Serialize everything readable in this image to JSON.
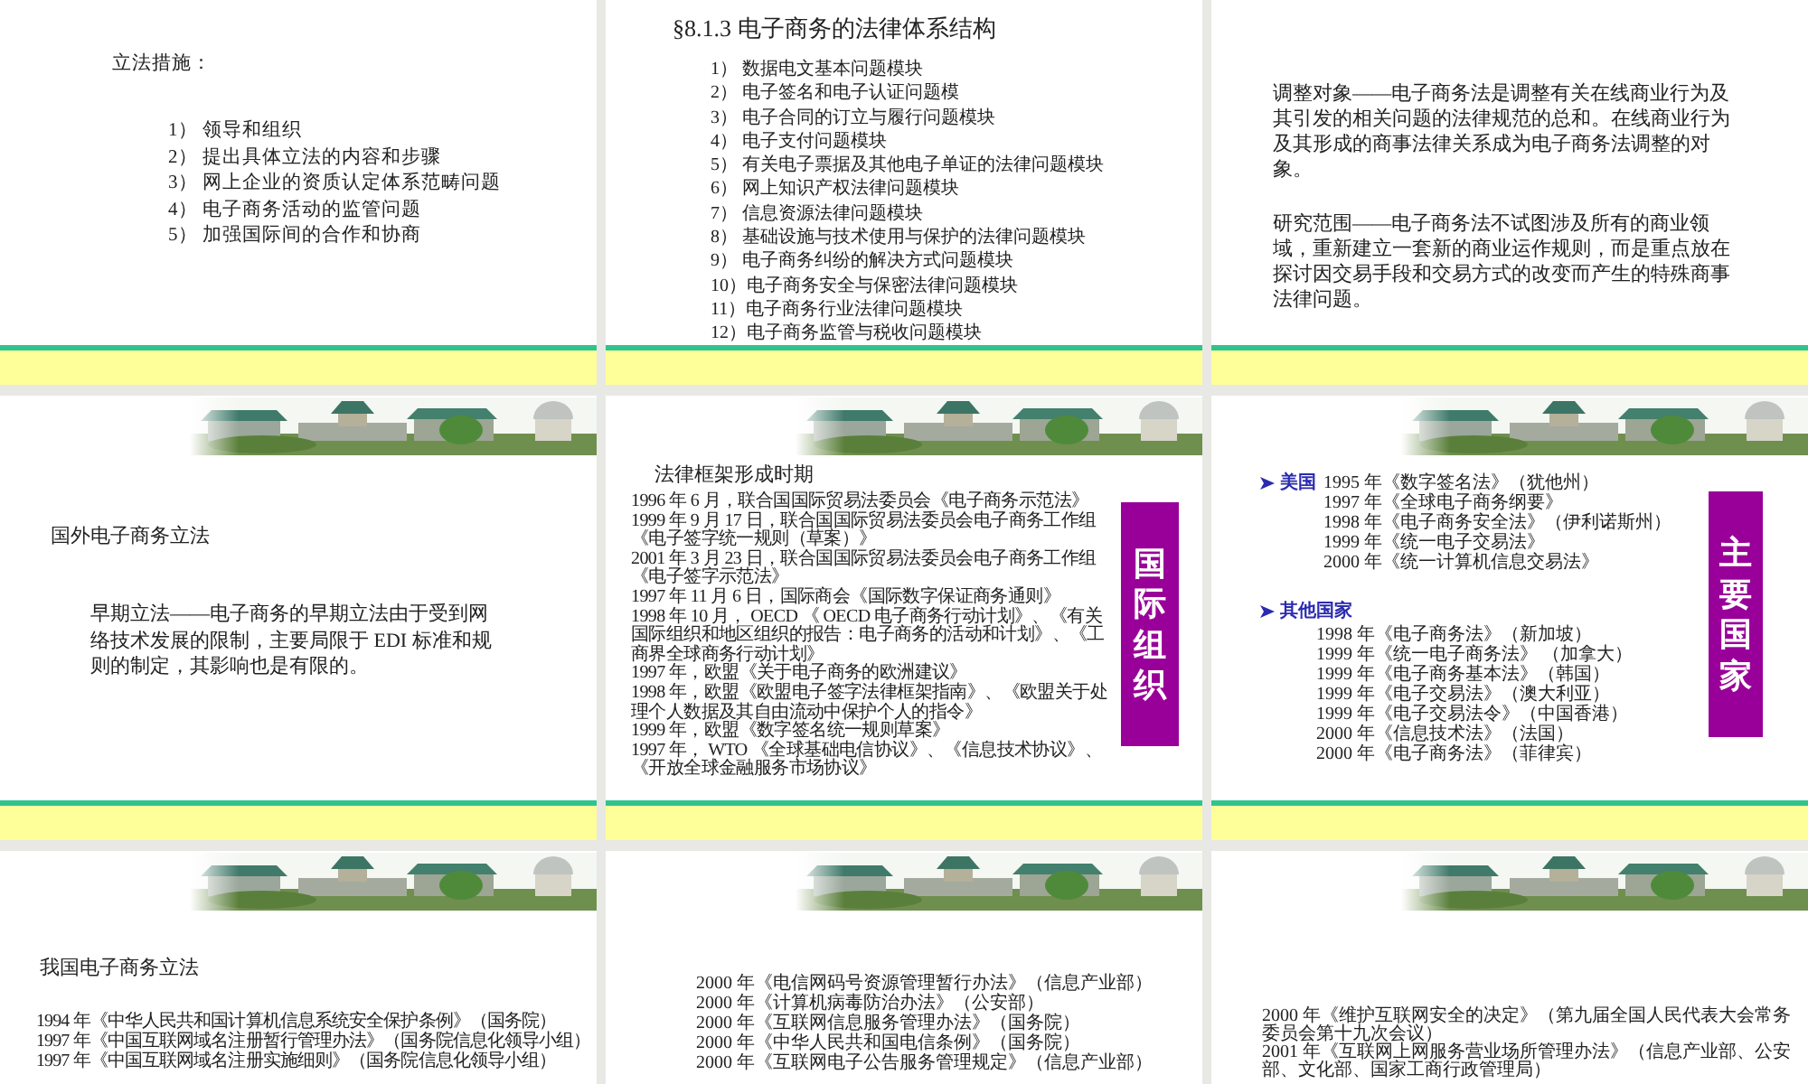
{
  "slides": [
    {
      "banner": false,
      "blocks": [
        {
          "kind": "heading",
          "text": "立法措施："
        },
        {
          "kind": "list",
          "items": [
            "1） 领导和组织",
            "2） 提出具体立法的内容和步骤",
            "3） 网上企业的资质认定体系范畴问题",
            "4） 电子商务活动的监管问题",
            "5） 加强国际间的合作和协商"
          ]
        }
      ]
    },
    {
      "banner": false,
      "blocks": [
        {
          "kind": "title",
          "text": "§8.1.3  电子商务的法律体系结构"
        },
        {
          "kind": "list",
          "items": [
            "1） 数据电文基本问题模块",
            "2） 电子签名和电子认证问题模",
            "3） 电子合同的订立与履行问题模块",
            "4） 电子支付问题模块",
            "5） 有关电子票据及其他电子单证的法律问题模块",
            "6） 网上知识产权法律问题模块",
            "7） 信息资源法律问题模块",
            "8） 基础设施与技术使用与保护的法律问题模块",
            "9） 电子商务纠纷的解决方式问题模块",
            "10）电子商务安全与保密法律问题模块",
            "11）电子商务行业法律问题模块",
            "12）电子商务监管与税收问题模块"
          ]
        }
      ]
    },
    {
      "banner": false,
      "blocks": [
        {
          "kind": "paragraph",
          "text": "调整对象——电子商务法是调整有关在线商业行为及其引发的相关问题的法律规范的总和。在线商业行为及其形成的商事法律关系成为电子商务法调整的对象。"
        },
        {
          "kind": "paragraph",
          "text": "研究范围——电子商务法不试图涉及所有的商业领域，重新建立一套新的商业运作规则，而是重点放在探讨因交易手段和交易方式的改变而产生的特殊商事法律问题。"
        }
      ]
    },
    {
      "banner": true,
      "blocks": [
        {
          "kind": "heading",
          "text": "国外电子商务立法"
        },
        {
          "kind": "paragraph",
          "text": "早期立法——电子商务的早期立法由于受到网络技术发展的限制，主要局限于  EDI 标准和规则的制定，其影响也是有限的。"
        }
      ]
    },
    {
      "banner": true,
      "side_label": "国际组织",
      "blocks": [
        {
          "kind": "heading",
          "text": "法律框架形成时期"
        },
        {
          "kind": "list",
          "items": [
            "1996 年 6 月，联合国国际贸易法委员会《电子商务示范法》",
            "1999 年 9 月 17 日，联合国国际贸易法委员会电子商务工作组《电子签字统一规则（草案）》",
            "2001 年 3 月 23 日，联合国国际贸易法委员会电子商务工作组《电子签字示范法》",
            "1997 年 11 月 6 日，国际商会《国际数字保证商务通则》",
            "1998 年 10 月， OECD 《 OECD 电子商务行动计划》、《有关国际组织和地区组织的报告：电子商务的活动和计划》、《工商界全球商务行动计划》",
            "1997 年，欧盟《关于电子商务的欧洲建议》",
            "1998 年，欧盟《欧盟电子签字法律框架指南》、《欧盟关于处理个人数据及其自由流动中保护个人的指令》",
            "1999 年，欧盟《数字签名统一规则草案》",
            "1997 年， WTO 《全球基础电信协议》、《信息技术协议》、《开放全球金融服务市场协议》"
          ]
        }
      ]
    },
    {
      "banner": true,
      "side_label": "主要国家",
      "blocks": [
        {
          "kind": "group",
          "label": "美国",
          "items": [
            "1995 年《数字签名法》（犹他州）",
            "1997 年《全球电子商务纲要》",
            "1998 年《电子商务安全法》（伊利诺斯州）",
            "1999 年《统一电子交易法》",
            "2000 年《统一计算机信息交易法》"
          ]
        },
        {
          "kind": "group",
          "label": "其他国家",
          "items": [
            "1998 年《电子商务法》（新加坡）",
            "1999 年《统一电子商务法》 （加拿大）",
            "1999 年《电子商务基本法》（韩国）",
            "1999 年《电子交易法》（澳大利亚）",
            "1999 年《电子交易法令》（中国香港）",
            "2000 年《信息技术法》（法国）",
            "2000 年《电子商务法》（菲律宾）"
          ]
        }
      ]
    },
    {
      "banner": true,
      "blocks": [
        {
          "kind": "heading",
          "text": "我国电子商务立法"
        },
        {
          "kind": "list",
          "items": [
            "1994 年《中华人民共和国计算机信息系统安全保护条例》（国务院）",
            "1997 年《中国互联网域名注册暂行管理办法》（国务院信息化领导小组）",
            "1997 年《中国互联网域名注册实施细则》（国务院信息化领导小组）"
          ]
        }
      ]
    },
    {
      "banner": true,
      "blocks": [
        {
          "kind": "list",
          "items": [
            "2000 年《电信网码号资源管理暂行办法》（信息产业部）",
            "2000 年《计算机病毒防治办法》（公安部）",
            "2000 年《互联网信息服务管理办法》（国务院）",
            "2000 年《中华人民共和国电信条例》（国务院）",
            "2000 年《互联网电子公告服务管理规定》（信息产业部）"
          ]
        }
      ]
    },
    {
      "banner": true,
      "blocks": [
        {
          "kind": "list",
          "items": [
            "2000 年《维护互联网安全的决定》（第九届全国人民代表大会常务委员会第十九次会议）",
            "2001 年《互联网上网服务营业场所管理办法》（信息产业部、公安部、文化部、国家工商行政管理局）"
          ]
        }
      ]
    }
  ]
}
